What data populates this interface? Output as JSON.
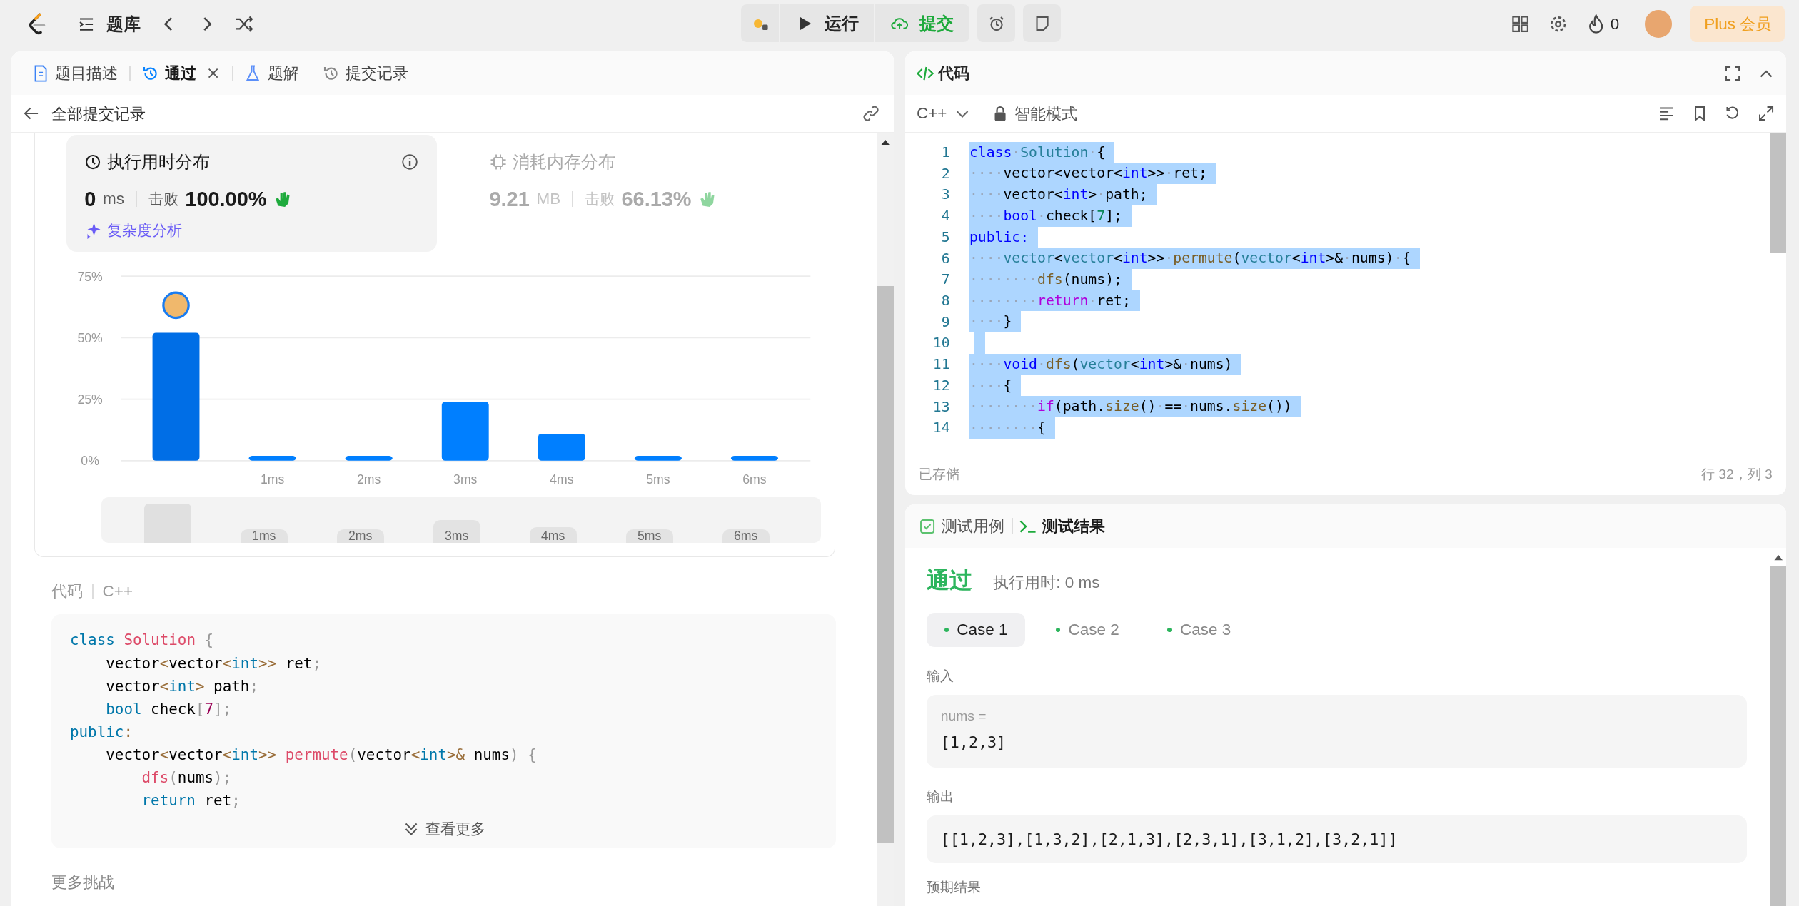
{
  "header": {
    "nav_label": "题库",
    "run_label": "运行",
    "submit_label": "提交",
    "streak": "0",
    "plus_label": "Plus 会员"
  },
  "left_panel": {
    "tabs": [
      {
        "label": "题目描述",
        "selected": false,
        "closable": false
      },
      {
        "label": "通过",
        "selected": true,
        "closable": true
      },
      {
        "label": "题解",
        "selected": false,
        "closable": false
      },
      {
        "label": "提交记录",
        "selected": false,
        "closable": false
      }
    ],
    "back_label": "全部提交记录",
    "runtime": {
      "title": "执行用时分布",
      "value": "0",
      "unit": "ms",
      "beats_label": "击败",
      "beats": "100.00%",
      "analysis_link": "复杂度分析",
      "selected": true
    },
    "memory": {
      "title": "消耗内存分布",
      "value": "9.21",
      "unit": "MB",
      "beats_label": "击败",
      "beats": "66.13%",
      "selected": false
    },
    "chart_data": {
      "type": "bar",
      "x": [
        0,
        1,
        2,
        3,
        4,
        5,
        6
      ],
      "values": [
        52,
        2,
        2,
        24,
        11,
        2,
        2
      ],
      "xlim": [
        -0.57,
        6.58
      ],
      "ylim": [
        0,
        75
      ],
      "yticks": [
        {
          "value": 0,
          "label": "0%"
        },
        {
          "value": 25,
          "label": "25%"
        },
        {
          "value": 50,
          "label": "50%"
        },
        {
          "value": 75,
          "label": "75%"
        }
      ],
      "xticks": [
        {
          "value": 1,
          "label": "1ms"
        },
        {
          "value": 2,
          "label": "2ms"
        },
        {
          "value": 3,
          "label": "3ms"
        },
        {
          "value": 4,
          "label": "4ms"
        },
        {
          "value": 5,
          "label": "5ms"
        },
        {
          "value": 6,
          "label": "6ms"
        }
      ]
    },
    "minimap_labels": [
      "1ms",
      "2ms",
      "3ms",
      "4ms",
      "5ms",
      "6ms"
    ],
    "code_label": "代码",
    "code_language": "C++",
    "code_lines": [
      [
        {
          "text": "class ",
          "kind": "keyword"
        },
        {
          "text": "Solution",
          "kind": "function"
        },
        {
          "text": " {",
          "kind": "punct"
        }
      ],
      [
        {
          "text": "    vector",
          "kind": "plain"
        },
        {
          "text": "<",
          "kind": "operator"
        },
        {
          "text": "vector",
          "kind": "plain"
        },
        {
          "text": "<",
          "kind": "operator"
        },
        {
          "text": "int",
          "kind": "keyword"
        },
        {
          "text": ">>",
          "kind": "operator"
        },
        {
          "text": " ret",
          "kind": "plain"
        },
        {
          "text": ";",
          "kind": "punct"
        }
      ],
      [
        {
          "text": "    vector",
          "kind": "plain"
        },
        {
          "text": "<",
          "kind": "operator"
        },
        {
          "text": "int",
          "kind": "keyword"
        },
        {
          "text": ">",
          "kind": "operator"
        },
        {
          "text": " path",
          "kind": "plain"
        },
        {
          "text": ";",
          "kind": "punct"
        }
      ],
      [
        {
          "text": "    bool",
          "kind": "keyword"
        },
        {
          "text": " check",
          "kind": "plain"
        },
        {
          "text": "[",
          "kind": "punct"
        },
        {
          "text": "7",
          "kind": "number"
        },
        {
          "text": "];",
          "kind": "punct"
        }
      ],
      [
        {
          "text": "public",
          "kind": "keyword"
        },
        {
          "text": ":",
          "kind": "operator"
        }
      ],
      [
        {
          "text": "    vector",
          "kind": "plain"
        },
        {
          "text": "<",
          "kind": "operator"
        },
        {
          "text": "vector",
          "kind": "plain"
        },
        {
          "text": "<",
          "kind": "operator"
        },
        {
          "text": "int",
          "kind": "keyword"
        },
        {
          "text": ">> ",
          "kind": "operator"
        },
        {
          "text": "permute",
          "kind": "function"
        },
        {
          "text": "(",
          "kind": "punct"
        },
        {
          "text": "vector",
          "kind": "plain"
        },
        {
          "text": "<",
          "kind": "operator"
        },
        {
          "text": "int",
          "kind": "keyword"
        },
        {
          "text": ">&",
          "kind": "operator"
        },
        {
          "text": " nums",
          "kind": "plain"
        },
        {
          "text": ") {",
          "kind": "punct"
        }
      ],
      [
        {
          "text": "        dfs",
          "kind": "function"
        },
        {
          "text": "(",
          "kind": "punct"
        },
        {
          "text": "nums",
          "kind": "plain"
        },
        {
          "text": ");",
          "kind": "punct"
        }
      ],
      [
        {
          "text": "        return",
          "kind": "keyword"
        },
        {
          "text": " ret",
          "kind": "plain"
        },
        {
          "text": ";",
          "kind": "punct"
        }
      ]
    ],
    "more_label": "查看更多",
    "more_challenges": "更多挑战"
  },
  "right_panel": {
    "title": "代码",
    "language": "C++",
    "mode": "智能模式",
    "lines": [
      {
        "number": "1",
        "tokens": [
          {
            "text": "class",
            "kind": "keyword"
          },
          {
            "text": "·",
            "kind": "space"
          },
          {
            "text": "Solution",
            "kind": "type"
          },
          {
            "text": "·",
            "kind": "space"
          },
          {
            "text": "{",
            "kind": "plain"
          }
        ]
      },
      {
        "number": "2",
        "tokens": [
          {
            "text": "····",
            "kind": "space"
          },
          {
            "text": "vector<vector<",
            "kind": "plain"
          },
          {
            "text": "int",
            "kind": "keyword"
          },
          {
            "text": ">>",
            "kind": "plain"
          },
          {
            "text": "·",
            "kind": "space"
          },
          {
            "text": "ret;",
            "kind": "plain"
          }
        ]
      },
      {
        "number": "3",
        "tokens": [
          {
            "text": "····",
            "kind": "space"
          },
          {
            "text": "vector<",
            "kind": "plain"
          },
          {
            "text": "int",
            "kind": "keyword"
          },
          {
            "text": ">",
            "kind": "plain"
          },
          {
            "text": "·",
            "kind": "space"
          },
          {
            "text": "path;",
            "kind": "plain"
          }
        ]
      },
      {
        "number": "4",
        "tokens": [
          {
            "text": "····",
            "kind": "space"
          },
          {
            "text": "bool",
            "kind": "keyword"
          },
          {
            "text": "·",
            "kind": "space"
          },
          {
            "text": "check[",
            "kind": "plain"
          },
          {
            "text": "7",
            "kind": "number"
          },
          {
            "text": "];",
            "kind": "plain"
          }
        ]
      },
      {
        "number": "5",
        "tokens": [
          {
            "text": "public:",
            "kind": "keyword"
          }
        ]
      },
      {
        "number": "6",
        "tokens": [
          {
            "text": "····",
            "kind": "space"
          },
          {
            "text": "vector",
            "kind": "type"
          },
          {
            "text": "<",
            "kind": "plain"
          },
          {
            "text": "vector",
            "kind": "type"
          },
          {
            "text": "<",
            "kind": "plain"
          },
          {
            "text": "int",
            "kind": "keyword"
          },
          {
            "text": ">>",
            "kind": "plain"
          },
          {
            "text": "·",
            "kind": "space"
          },
          {
            "text": "permute",
            "kind": "function"
          },
          {
            "text": "(",
            "kind": "plain"
          },
          {
            "text": "vector",
            "kind": "type"
          },
          {
            "text": "<",
            "kind": "plain"
          },
          {
            "text": "int",
            "kind": "keyword"
          },
          {
            "text": ">&",
            "kind": "plain"
          },
          {
            "text": "·",
            "kind": "space"
          },
          {
            "text": "nums)",
            "kind": "plain"
          },
          {
            "text": "·",
            "kind": "space"
          },
          {
            "text": "{",
            "kind": "plain"
          }
        ]
      },
      {
        "number": "7",
        "tokens": [
          {
            "text": "········",
            "kind": "space"
          },
          {
            "text": "dfs",
            "kind": "function"
          },
          {
            "text": "(nums);",
            "kind": "plain"
          }
        ]
      },
      {
        "number": "8",
        "tokens": [
          {
            "text": "········",
            "kind": "space"
          },
          {
            "text": "return",
            "kind": "control"
          },
          {
            "text": "·",
            "kind": "space"
          },
          {
            "text": "ret;",
            "kind": "plain"
          }
        ]
      },
      {
        "number": "9",
        "tokens": [
          {
            "text": "····",
            "kind": "space"
          },
          {
            "text": "}",
            "kind": "plain"
          }
        ]
      },
      {
        "number": "10"
      },
      {
        "number": "11",
        "tokens": [
          {
            "text": "····",
            "kind": "space"
          },
          {
            "text": "void",
            "kind": "keyword"
          },
          {
            "text": "·",
            "kind": "space"
          },
          {
            "text": "dfs",
            "kind": "function"
          },
          {
            "text": "(",
            "kind": "plain"
          },
          {
            "text": "vector",
            "kind": "type"
          },
          {
            "text": "<",
            "kind": "plain"
          },
          {
            "text": "int",
            "kind": "keyword"
          },
          {
            "text": ">&",
            "kind": "plain"
          },
          {
            "text": "·",
            "kind": "space"
          },
          {
            "text": "nums)",
            "kind": "plain"
          }
        ]
      },
      {
        "number": "12",
        "tokens": [
          {
            "text": "····",
            "kind": "space"
          },
          {
            "text": "{",
            "kind": "plain"
          }
        ]
      },
      {
        "number": "13",
        "tokens": [
          {
            "text": "········",
            "kind": "space"
          },
          {
            "text": "if",
            "kind": "control"
          },
          {
            "text": "(path.",
            "kind": "plain"
          },
          {
            "text": "size",
            "kind": "function"
          },
          {
            "text": "()",
            "kind": "plain"
          },
          {
            "text": "·",
            "kind": "space"
          },
          {
            "text": "==",
            "kind": "plain"
          },
          {
            "text": "·",
            "kind": "space"
          },
          {
            "text": "nums.",
            "kind": "plain"
          },
          {
            "text": "size",
            "kind": "function"
          },
          {
            "text": "())",
            "kind": "plain"
          }
        ]
      },
      {
        "number": "14",
        "tokens": [
          {
            "text": "········",
            "kind": "space"
          },
          {
            "text": "{",
            "kind": "plain"
          }
        ]
      }
    ],
    "saved_label": "已存储",
    "cursor": "行 32，列 3",
    "test_tabs": [
      {
        "label": "测试用例",
        "selected": false
      },
      {
        "label": "测试结果",
        "selected": true
      }
    ],
    "result": {
      "status": "通过",
      "runtime": "执行用时: 0 ms",
      "cases": [
        {
          "label": "Case 1",
          "selected": true
        },
        {
          "label": "Case 2",
          "selected": false
        },
        {
          "label": "Case 3",
          "selected": false
        }
      ],
      "input_label": "输入",
      "input_name": "nums =",
      "input_value": "[1,2,3]",
      "output_label": "输出",
      "output_value": "[[1,2,3],[1,3,2],[2,1,3],[2,3,1],[3,1,2],[3,2,1]]",
      "expected_label": "预期结果"
    }
  }
}
